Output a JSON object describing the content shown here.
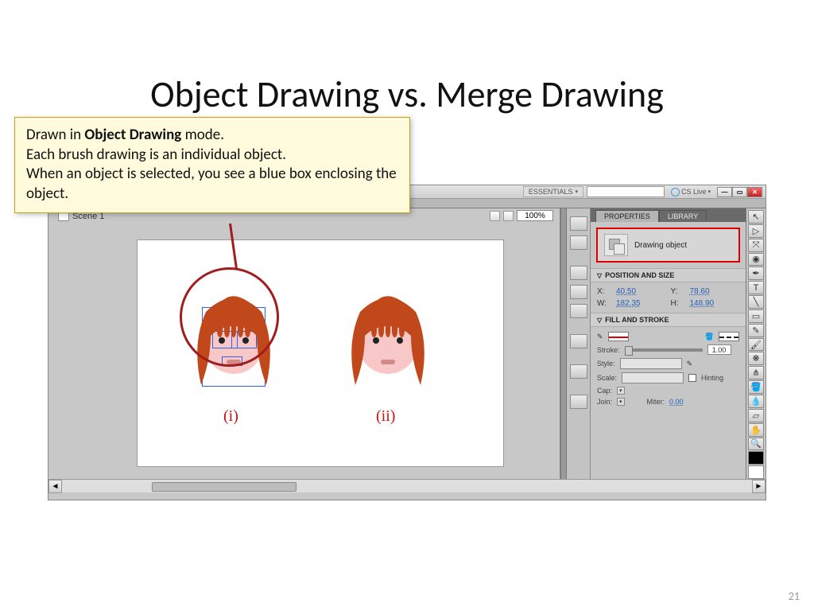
{
  "title": "Object Drawing vs. Merge Drawing",
  "page_number": "21",
  "callout": {
    "line1_pre": "Drawn in ",
    "line1_bold": "Object Drawing",
    "line1_post": " mode.",
    "line2": "Each  brush drawing is an individual object.",
    "line3": "When an object is selected, you see a blue box enclosing the object."
  },
  "app": {
    "workspace": "ESSENTIALS",
    "cs_live": "CS Live",
    "scene_tab": "Scene 1",
    "zoom": "100%",
    "labels": {
      "i": "(i)",
      "ii": "(ii)"
    }
  },
  "panels": {
    "tabs": {
      "properties": "PROPERTIES",
      "library": "LIBRARY"
    },
    "drawing_object": "Drawing object",
    "position_head": "POSITION AND SIZE",
    "position": {
      "x_label": "X:",
      "x": "40.50",
      "y_label": "Y:",
      "y": "78.60",
      "w_label": "W:",
      "w": "182.35",
      "h_label": "H:",
      "h": "148.90"
    },
    "fill_head": "FILL AND STROKE",
    "stroke": {
      "label": "Stroke:",
      "value": "1.00"
    },
    "style_label": "Style:",
    "scale_label": "Scale:",
    "hinting_label": "Hinting",
    "cap_label": "Cap:",
    "join_label": "Join:",
    "miter_label": "Miter:",
    "miter_value": "0.00"
  }
}
